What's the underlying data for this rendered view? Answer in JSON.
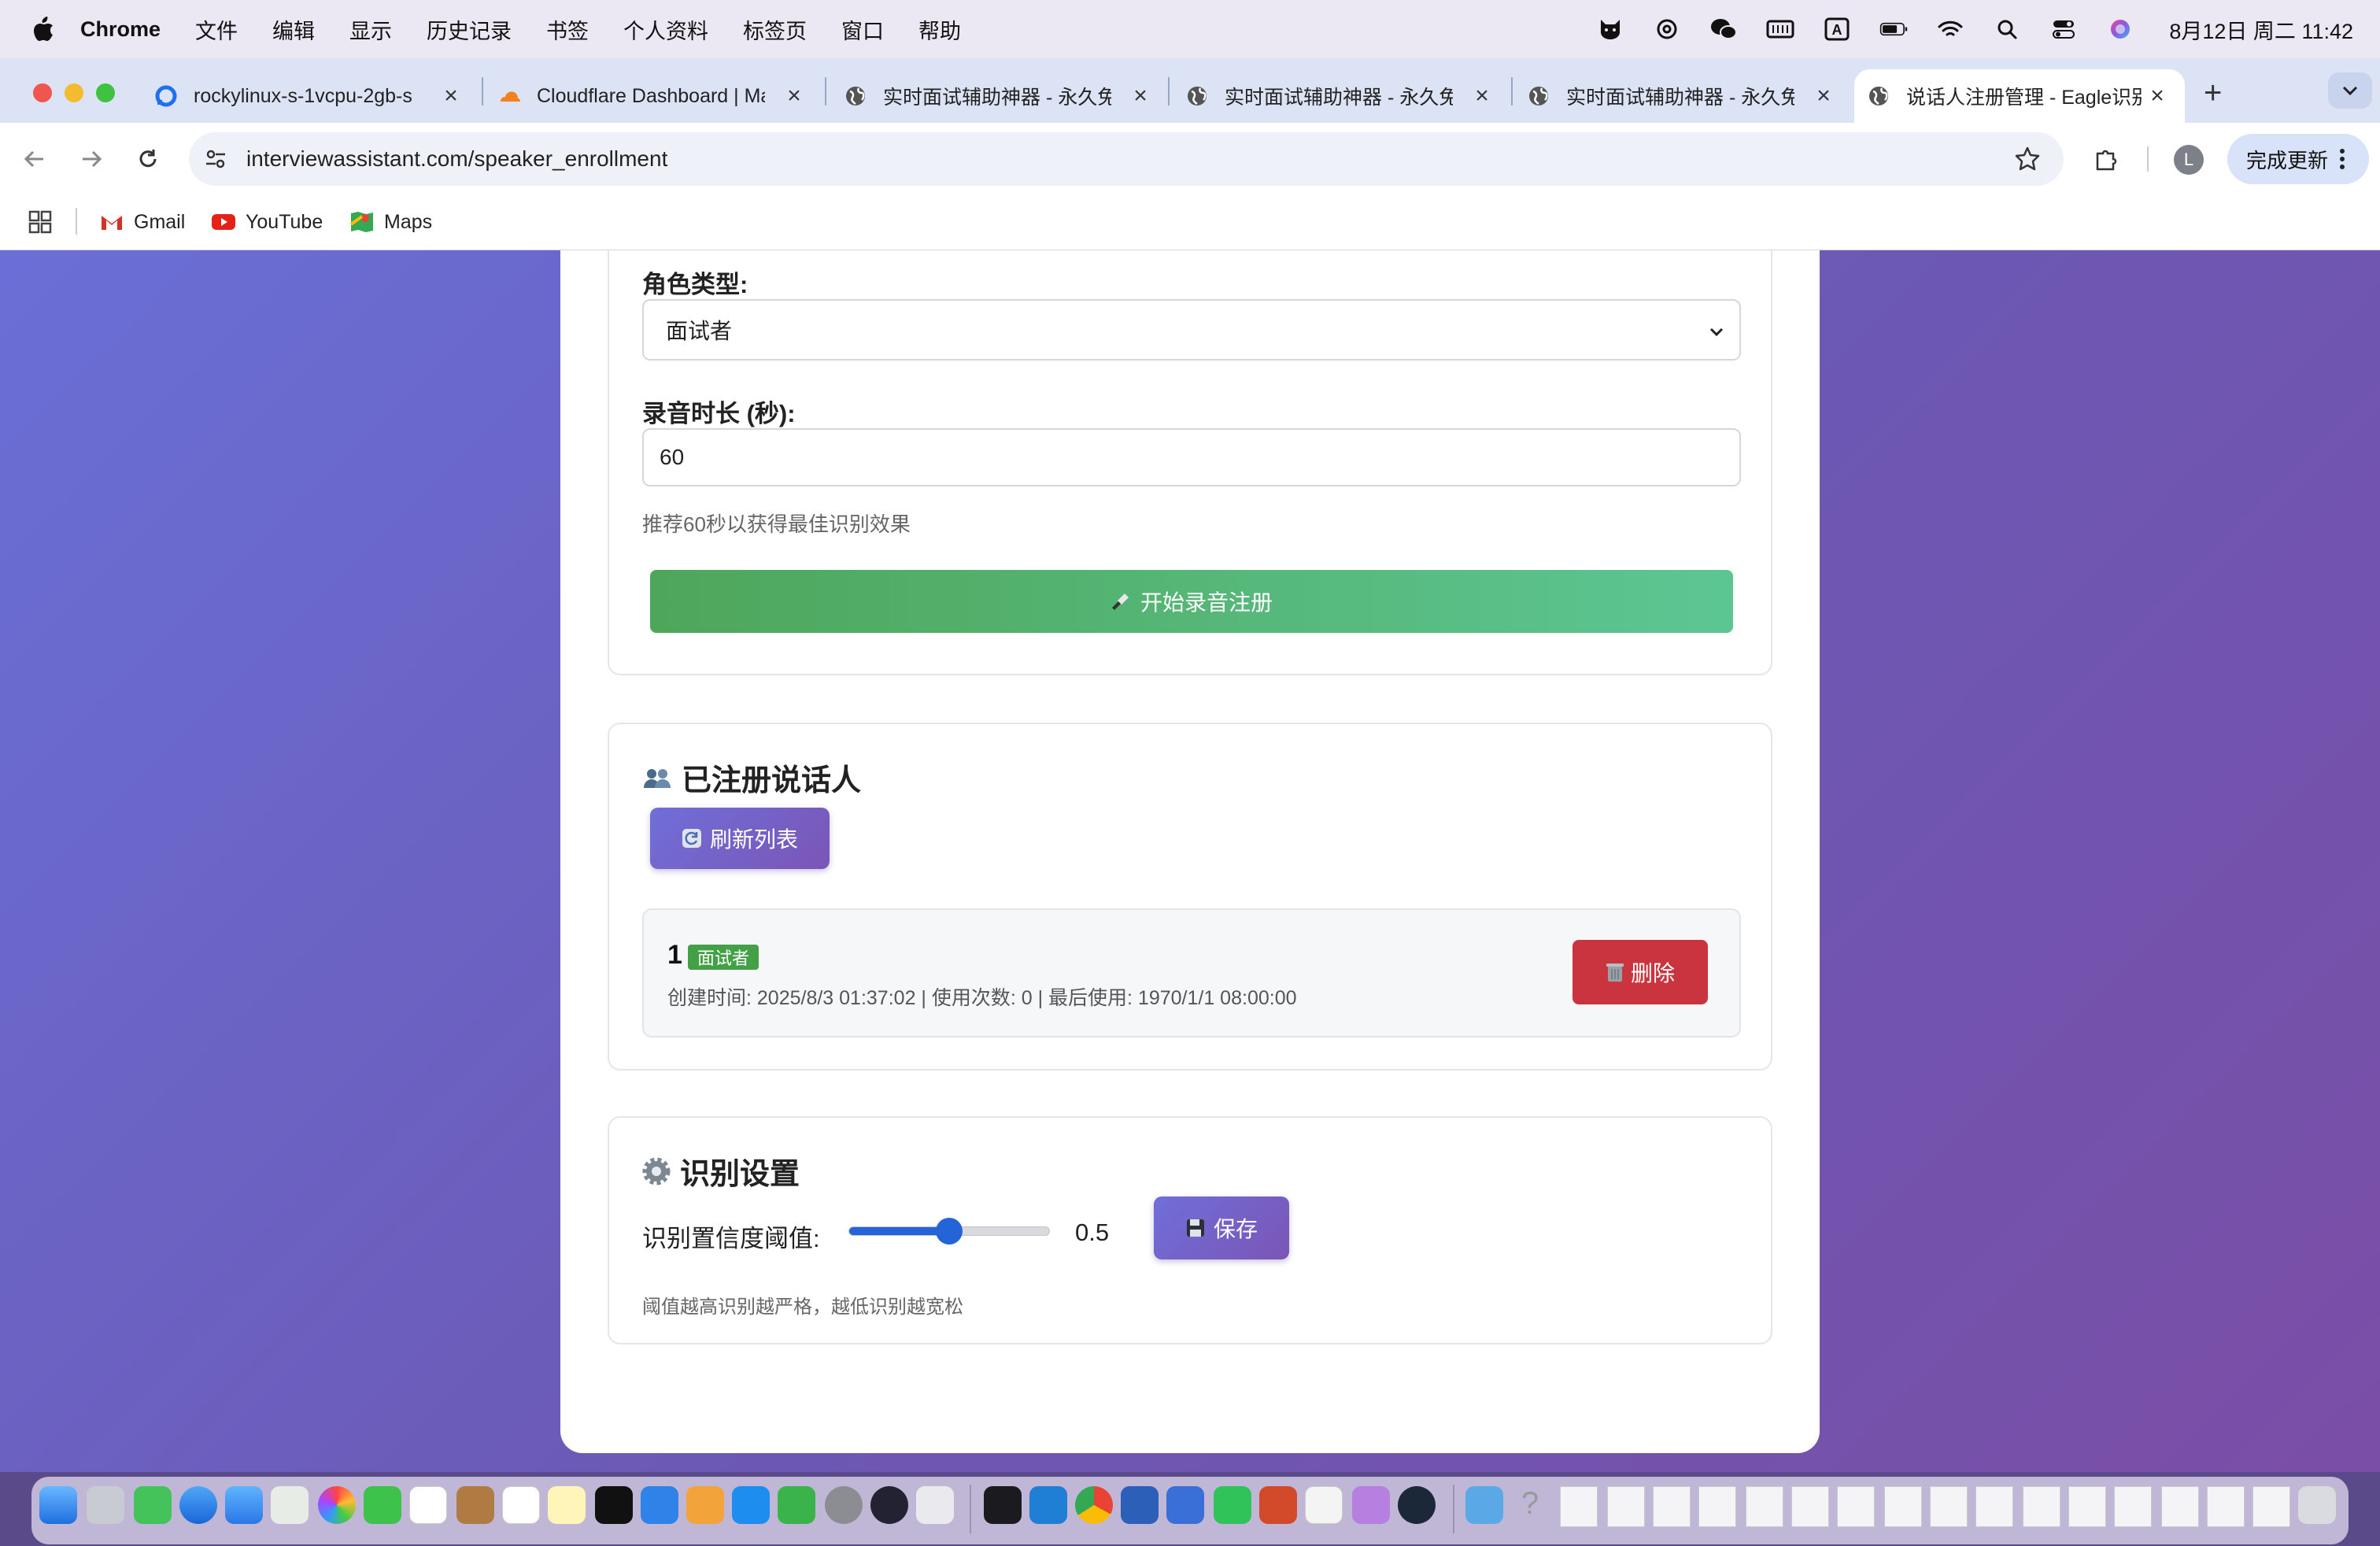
{
  "menubar": {
    "app_name": "Chrome",
    "items": [
      "文件",
      "编辑",
      "显示",
      "历史记录",
      "书签",
      "个人资料",
      "标签页",
      "窗口",
      "帮助"
    ],
    "clock": "8月12日 周二  11:42",
    "status_icons": [
      "cat-icon",
      "openai-icon",
      "wechat-icon",
      "keyboard-icon",
      "input-method-icon",
      "battery-icon",
      "wifi-icon",
      "spotlight-search-icon",
      "control-center-icon",
      "siri-icon"
    ]
  },
  "tabs": [
    {
      "title": "rockylinux-s-1vcpu-2gb-s",
      "icon": "digitalocean-icon",
      "active": false
    },
    {
      "title": "Cloudflare Dashboard | Ma",
      "icon": "cloudflare-icon",
      "active": false
    },
    {
      "title": "实时面试辅助神器 - 永久免",
      "icon": "globe-icon",
      "active": false
    },
    {
      "title": "实时面试辅助神器 - 永久免",
      "icon": "globe-icon",
      "active": false
    },
    {
      "title": "实时面试辅助神器 - 永久免",
      "icon": "globe-icon",
      "active": false
    },
    {
      "title": "说话人注册管理 - Eagle识别",
      "icon": "globe-icon",
      "active": true
    }
  ],
  "toolbar": {
    "url": "interviewassistant.com/speaker_enrollment",
    "update_label": "完成更新",
    "avatar_letter": "L"
  },
  "bookmarks": [
    {
      "label": "Gmail",
      "icon": "gmail-icon"
    },
    {
      "label": "YouTube",
      "icon": "youtube-icon"
    },
    {
      "label": "Maps",
      "icon": "maps-icon"
    }
  ],
  "enroll": {
    "role_label": "角色类型:",
    "role_value": "面试者",
    "duration_label": "录音时长 (秒):",
    "duration_value": "60",
    "duration_hint": "推荐60秒以获得最佳识别效果",
    "record_button": "开始录音注册"
  },
  "speakers": {
    "title": "已注册说话人",
    "refresh_button": "刷新列表",
    "list": [
      {
        "name": "1",
        "role": "面试者",
        "meta": "创建时间: 2025/8/3 01:37:02 | 使用次数: 0 | 最后使用: 1970/1/1 08:00:00",
        "delete_label": "删除"
      }
    ]
  },
  "settings": {
    "title": "识别设置",
    "threshold_label": "识别置信度阈值:",
    "threshold_value": "0.5",
    "threshold_level": 0.5,
    "save_button": "保存",
    "hint": "阈值越高识别越严格，越低识别越宽松"
  },
  "colors": {
    "accent_purple": "#6f6fd8",
    "record_green": "#4ea65a",
    "delete_red": "#c9343e",
    "badge_green": "#43a047",
    "slider_blue": "#2563d8"
  }
}
